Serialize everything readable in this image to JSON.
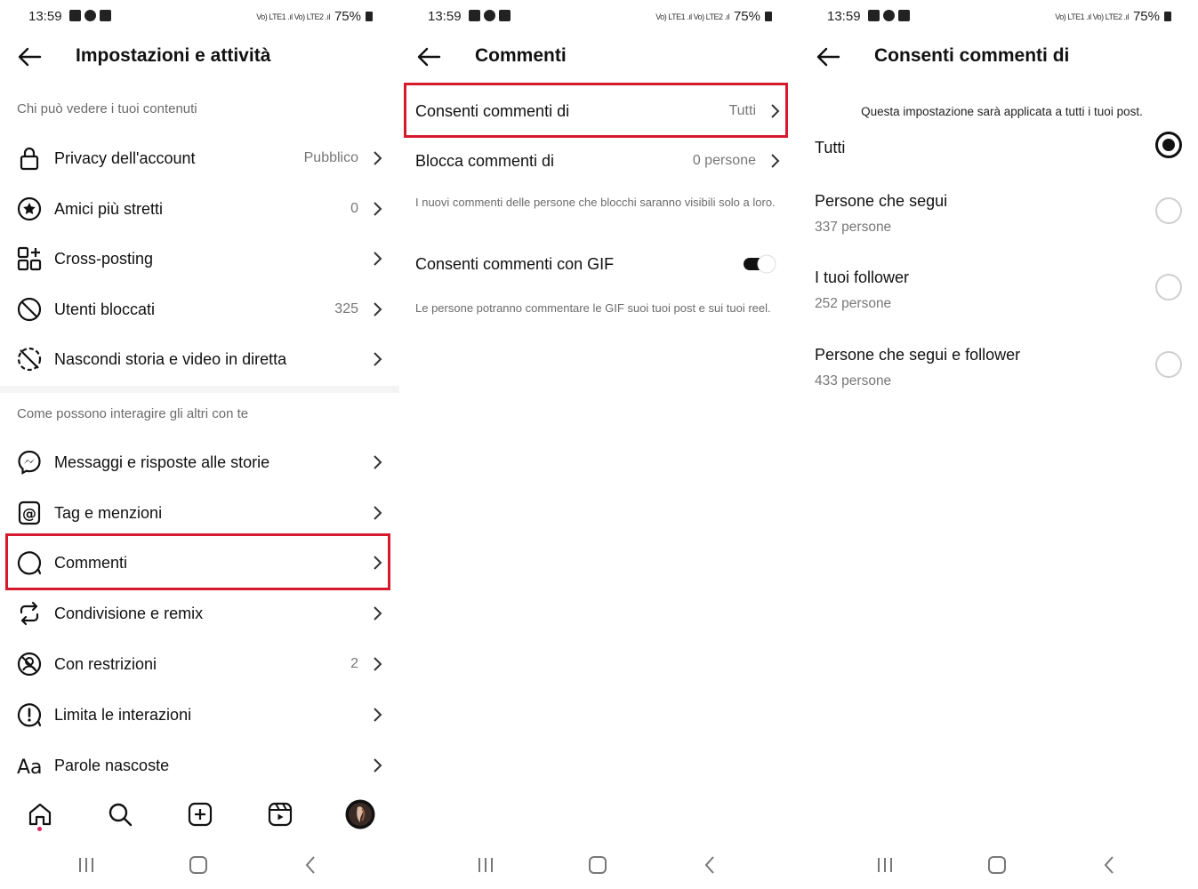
{
  "status_bar": {
    "time": "13:59",
    "network": "Vo) LTE1 .ıl Vo) LTE2 .ıl",
    "battery": "75%"
  },
  "colors": {
    "highlight": "#d7192e",
    "text": "#111111",
    "muted": "#6b6b6b",
    "notification_dot": "#e0245e"
  },
  "panel1": {
    "title": "Impostazioni e attività",
    "section1": "Chi può vedere i tuoi contenuti",
    "items1": [
      {
        "label": "Privacy dell'account",
        "value": "Pubblico",
        "icon": "lock-icon"
      },
      {
        "label": "Amici più stretti",
        "value": "0",
        "icon": "star-circle-icon"
      },
      {
        "label": "Cross-posting",
        "value": "",
        "icon": "grid-plus-icon"
      },
      {
        "label": "Utenti bloccati",
        "value": "325",
        "icon": "block-icon"
      },
      {
        "label": "Nascondi storia e video in diretta",
        "value": "",
        "icon": "hide-story-icon"
      }
    ],
    "section2": "Come possono interagire gli altri con te",
    "items2": [
      {
        "label": "Messaggi e risposte alle storie",
        "value": "",
        "icon": "messenger-icon"
      },
      {
        "label": "Tag e menzioni",
        "value": "",
        "icon": "at-icon"
      },
      {
        "label": "Commenti",
        "value": "",
        "icon": "comment-icon"
      },
      {
        "label": "Condivisione e remix",
        "value": "",
        "icon": "remix-icon"
      },
      {
        "label": "Con restrizioni",
        "value": "2",
        "icon": "restrict-icon"
      },
      {
        "label": "Limita le interazioni",
        "value": "",
        "icon": "limit-icon"
      },
      {
        "label": "Parole nascoste",
        "value": "",
        "icon": "text-aa-icon"
      }
    ]
  },
  "panel2": {
    "title": "Commenti",
    "allow_label": "Consenti commenti di",
    "allow_value": "Tutti",
    "block_label": "Blocca commenti di",
    "block_value": "0 persone",
    "block_note": "I nuovi commenti delle persone che blocchi saranno visibili solo a loro.",
    "gif_label": "Consenti commenti con GIF",
    "gif_enabled": true,
    "gif_note": "Le persone potranno commentare le GIF suoi tuoi post e sui tuoi reel."
  },
  "panel3": {
    "title": "Consenti commenti di",
    "description": "Questa impostazione sarà applicata a tutti i tuoi post.",
    "options": [
      {
        "label": "Tutti",
        "sub": "",
        "selected": true
      },
      {
        "label": "Persone che segui",
        "sub": "337 persone",
        "selected": false
      },
      {
        "label": "I tuoi follower",
        "sub": "252 persone",
        "selected": false
      },
      {
        "label": "Persone che segui e follower",
        "sub": "433 persone",
        "selected": false
      }
    ]
  }
}
